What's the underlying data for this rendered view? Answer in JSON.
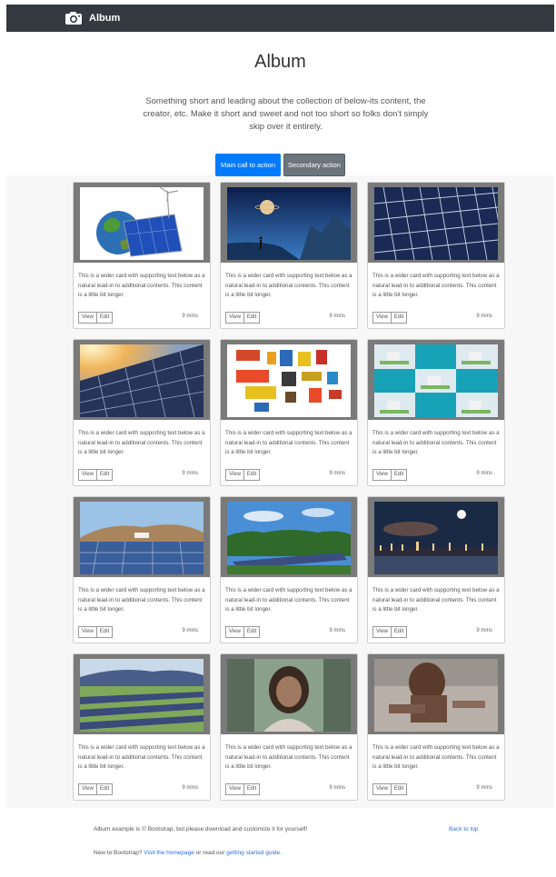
{
  "navbar": {
    "brand": "Album",
    "icon": "camera-icon"
  },
  "hero": {
    "title": "Album",
    "lead": "Something short and leading about the collection of below-its content, the creator, etc. Make it short and sweet and not too short so folks don't simply skip over it entirely.",
    "primary_button": "Main call to action",
    "secondary_button": "Secondary action"
  },
  "cards": [
    {
      "image": "earth-solar-panel-windmill",
      "text": "This is a wider card with supporting text below as a natural lead-in to additional contents. This content is a little bit longer.",
      "view": "View",
      "edit": "Edit",
      "time": "9 mins"
    },
    {
      "image": "space-planet-landscape",
      "text": "This is a wider card with supporting text below as a natural lead-in to additional contents. This content is a little bit longer.",
      "view": "View",
      "edit": "Edit",
      "time": "9 mins"
    },
    {
      "image": "solar-panel-closeup",
      "text": "This is a wider card with supporting text below as a natural lead-in to additional contents. This content is a little bit longer.",
      "view": "View",
      "edit": "Edit",
      "time": "9 mins"
    },
    {
      "image": "solar-panels-sunlight",
      "text": "This is a wider card with supporting text below as a natural lead-in to additional contents. This content is a little bit longer.",
      "view": "View",
      "edit": "Edit",
      "time": "9 mins"
    },
    {
      "image": "batteries-collection",
      "text": "This is a wider card with supporting text below as a natural lead-in to additional contents. This content is a little bit longer.",
      "view": "View",
      "edit": "Edit",
      "time": "9 mins"
    },
    {
      "image": "power-plant-icons-grid",
      "text": "This is a wider card with supporting text below as a natural lead-in to additional contents. This content is a little bit longer.",
      "view": "View",
      "edit": "Edit",
      "time": "9 mins"
    },
    {
      "image": "solar-farm-hills",
      "text": "This is a wider card with supporting text below as a natural lead-in to additional contents. This content is a little bit longer.",
      "view": "View",
      "edit": "Edit",
      "time": "9 mins"
    },
    {
      "image": "solar-farm-forest",
      "text": "This is a wider card with supporting text below as a natural lead-in to additional contents. This content is a little bit longer.",
      "view": "View",
      "edit": "Edit",
      "time": "9 mins"
    },
    {
      "image": "city-night-moon",
      "text": "This is a wider card with supporting text below as a natural lead-in to additional contents. This content is a little bit longer.",
      "view": "View",
      "edit": "Edit",
      "time": "9 mins"
    },
    {
      "image": "solar-farm-field",
      "text": "This is a wider card with supporting text below as a natural lead-in to additional contents. This content is a little bit longer.",
      "view": "View",
      "edit": "Edit",
      "time": "9 mins"
    },
    {
      "image": "blurred-portrait",
      "text": "This is a wider card with supporting text below as a natural lead-in to additional contents. This content is a little bit longer.",
      "view": "View",
      "edit": "Edit",
      "time": "9 mins"
    },
    {
      "image": "blurred-person-photo",
      "text": "This is a wider card with supporting text below as a natural lead-in to additional contents. This content is a little bit longer.",
      "view": "View",
      "edit": "Edit",
      "time": "9 mins"
    }
  ],
  "footer": {
    "copyright": "Album example is © Bootstrap, but please download and customize it for yourself!",
    "back_to_top": "Back to top",
    "new_to": "New to Bootstrap?",
    "visit_link": "Visit the homepage",
    "or_read": "or read our",
    "guide_link": "getting started guide."
  }
}
